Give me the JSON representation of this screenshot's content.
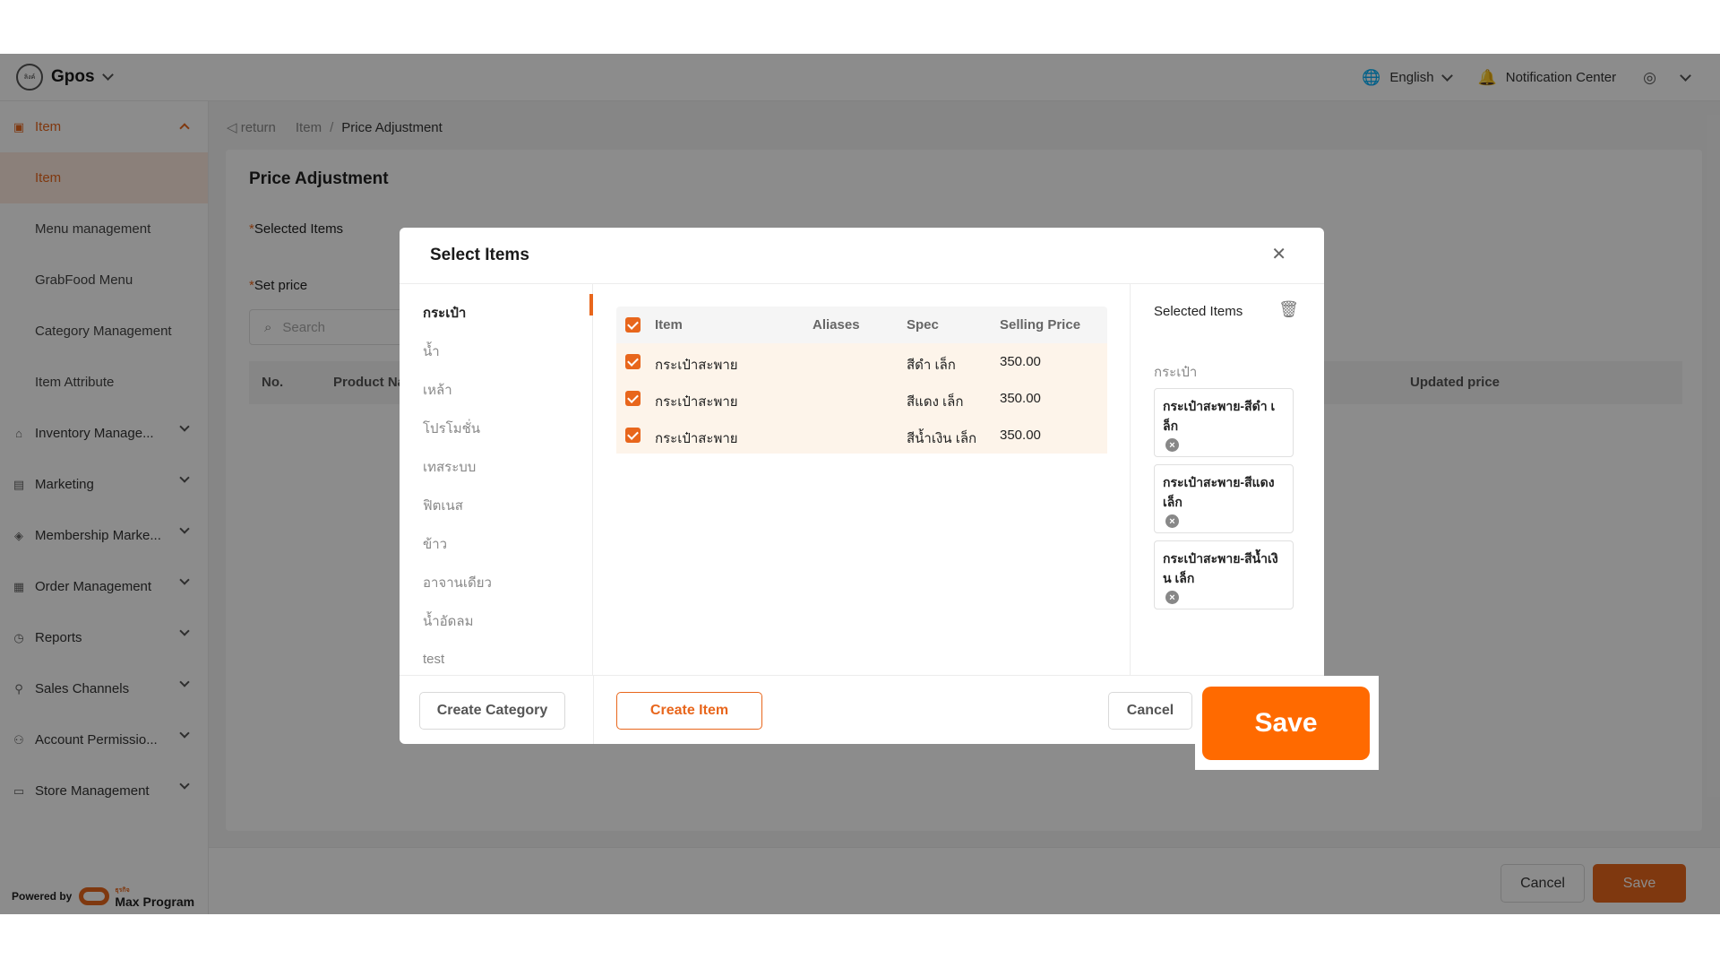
{
  "topbar": {
    "logo_text": "ลิงค์",
    "app_name": "Gpos",
    "language": "English",
    "notification_label": "Notification Center",
    "icons": [
      "globe-icon",
      "bell-icon",
      "user-icon",
      "chevron-down-icon"
    ]
  },
  "sidebar": {
    "groups": [
      {
        "label": "Item",
        "icon": "item-icon",
        "expanded": true
      },
      {
        "label": "Inventory Manage...",
        "icon": "warehouse-icon"
      },
      {
        "label": "Marketing",
        "icon": "marketing-icon"
      },
      {
        "label": "Membership Marke...",
        "icon": "membership-icon"
      },
      {
        "label": "Order Management",
        "icon": "order-icon"
      },
      {
        "label": "Reports",
        "icon": "report-icon"
      },
      {
        "label": "Sales Channels",
        "icon": "channels-icon"
      },
      {
        "label": "Account Permissio...",
        "icon": "account-icon"
      },
      {
        "label": "Store Management",
        "icon": "store-icon"
      }
    ],
    "item_children": [
      {
        "label": "Item",
        "active": true
      },
      {
        "label": "Menu management"
      },
      {
        "label": "GrabFood Menu"
      },
      {
        "label": "Category Management"
      },
      {
        "label": "Item Attribute"
      }
    ],
    "powered_by": "Powered by",
    "powered_brand_small": "ธุรกิจ",
    "powered_brand": "Max Program"
  },
  "breadcrumb": {
    "return_label": "return",
    "items": [
      "Item",
      "Price Adjustment"
    ],
    "separator": "/"
  },
  "page": {
    "title": "Price Adjustment",
    "selected_items_label": "Selected Items",
    "set_price_label": "Set price",
    "required_mark": "*",
    "search_placeholder": "Search",
    "table_headers": {
      "no": "No.",
      "product": "Product Na",
      "updated_price": "Updated price"
    },
    "footer": {
      "cancel": "Cancel",
      "save": "Save"
    }
  },
  "modal": {
    "title": "Select Items",
    "close_icon": "close-icon",
    "categories": [
      "กระเป๋า",
      "น้ำ",
      "เหล้า",
      "โปรโมชั่น",
      "เทสระบบ",
      "ฟิตเนส",
      "ข้าว",
      "อาจานเดียว",
      "น้ำอัดลม",
      "test"
    ],
    "active_category": "กระเป๋า",
    "columns": {
      "item": "Item",
      "aliases": "Aliases",
      "spec": "Spec",
      "selling_price": "Selling Price"
    },
    "rows": [
      {
        "item": "กระเป๋าสะพาย",
        "aliases": "",
        "spec": "สีดำ เล็ก",
        "price": "350.00",
        "checked": true
      },
      {
        "item": "กระเป๋าสะพาย",
        "aliases": "",
        "spec": "สีแดง เล็ก",
        "price": "350.00",
        "checked": true
      },
      {
        "item": "กระเป๋าสะพาย",
        "aliases": "",
        "spec": "สีน้ำเงิน เล็ก",
        "price": "350.00",
        "checked": true
      }
    ],
    "selected_panel": {
      "title": "Selected Items",
      "trash_icon": "trash-icon",
      "category": "กระเป๋า",
      "chips": [
        {
          "line1": "กระเป๋าสะพาย-สีดำ เ",
          "line2": "ล็ก"
        },
        {
          "line1": "กระเป๋าสะพาย-สีแดง",
          "line2": "เล็ก"
        },
        {
          "line1": "กระเป๋าสะพาย-สีน้ำเงิ",
          "line2": "น เล็ก"
        }
      ],
      "remove_glyph": "×"
    },
    "footer": {
      "create_category": "Create Category",
      "create_item": "Create Item",
      "cancel": "Cancel",
      "save": "Save"
    }
  },
  "colors": {
    "accent": "#e8661c",
    "save_highlight": "#ff6a00",
    "row_highlight": "#fdf4ea"
  }
}
